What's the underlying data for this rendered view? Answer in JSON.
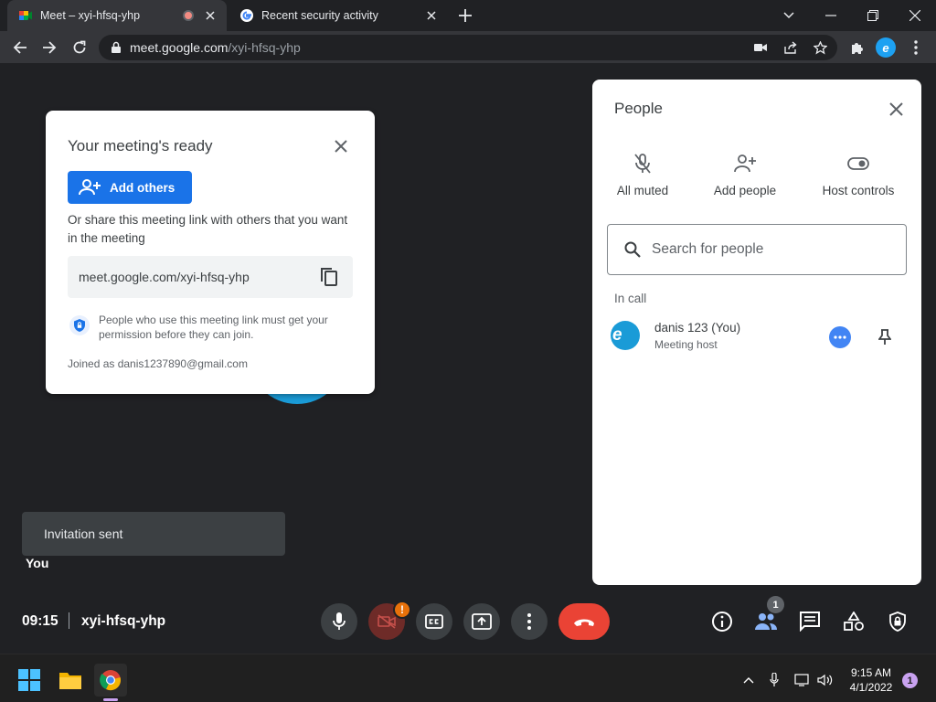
{
  "browser": {
    "tabs": [
      {
        "title": "Meet – xyi-hfsq-yhp",
        "active": true,
        "recording": true
      },
      {
        "title": "Recent security activity",
        "active": false
      }
    ],
    "address": {
      "host": "meet.google.com",
      "path": "/xyi-hfsq-yhp"
    },
    "profile_initial": "e"
  },
  "ready_card": {
    "heading": "Your meeting's ready",
    "add_others_label": "Add others",
    "share_text": "Or share this meeting link with others that you want in the meeting",
    "link": "meet.google.com/xyi-hfsq-yhp",
    "notice": "People who use this meeting link must get your permission before they can join.",
    "joined_as": "Joined as danis1237890@gmail.com"
  },
  "toast": {
    "text": "Invitation sent"
  },
  "self_tile": {
    "label": "You"
  },
  "people_panel": {
    "title": "People",
    "actions": [
      {
        "label": "All muted",
        "icon": "mic-off-icon"
      },
      {
        "label": "Add people",
        "icon": "person-add-icon"
      },
      {
        "label": "Host controls",
        "icon": "toggle-icon"
      }
    ],
    "search_placeholder": "Search for people",
    "section_label": "In call",
    "participants": [
      {
        "name": "danis 123 (You)",
        "role": "Meeting host",
        "initial": "e"
      }
    ]
  },
  "meeting_bar": {
    "time": "09:15",
    "meeting_code": "xyi-hfsq-yhp",
    "camera_warning": "!",
    "participant_count": "1"
  },
  "taskbar": {
    "clock_time": "9:15 AM",
    "clock_date": "4/1/2022",
    "notification_count": "1"
  },
  "colors": {
    "accent": "#1a73e8",
    "end_call": "#ea4335",
    "warning": "#e8710a",
    "avatar": "#1a9bd7"
  }
}
